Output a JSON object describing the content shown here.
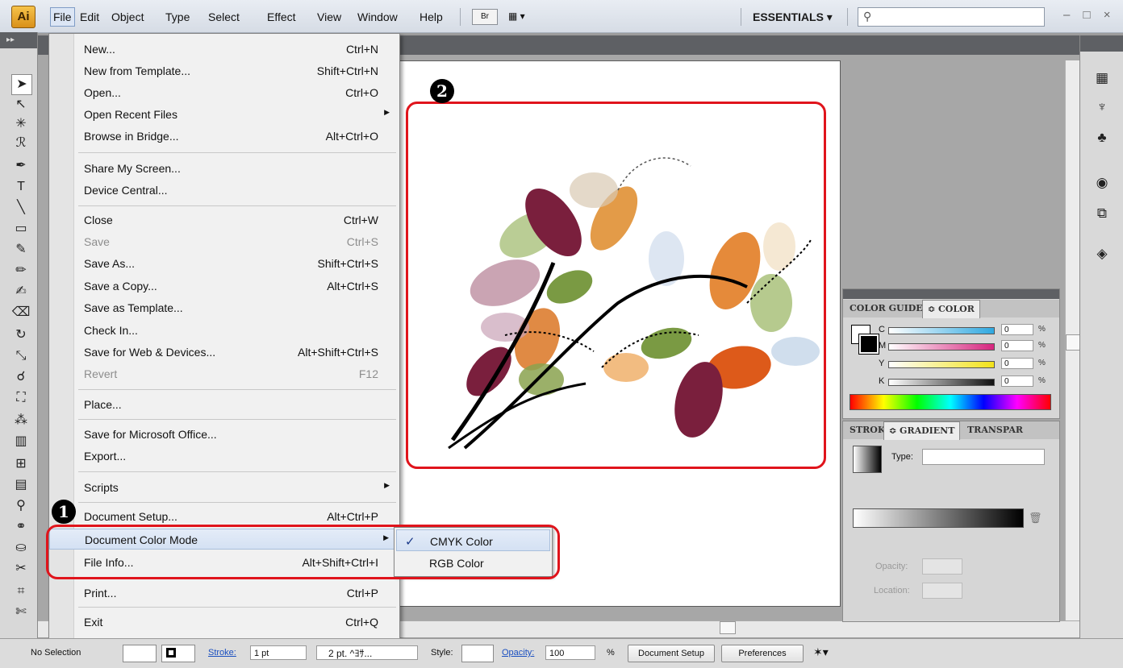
{
  "app": {
    "logo": "Ai",
    "workspace": "ESSENTIALS ▾",
    "bridge": "Br",
    "win_controls": "– □ ×"
  },
  "menubar": {
    "items": [
      "File",
      "Edit",
      "Object",
      "Type",
      "Select",
      "Effect",
      "View",
      "Window",
      "Help"
    ]
  },
  "file_menu": {
    "items": [
      {
        "label": "New...",
        "shortcut": "Ctrl+N"
      },
      {
        "label": "New from Template...",
        "shortcut": "Shift+Ctrl+N"
      },
      {
        "label": "Open...",
        "shortcut": "Ctrl+O"
      },
      {
        "label": "Open Recent Files",
        "shortcut": "",
        "submenu": true
      },
      {
        "label": "Browse in Bridge...",
        "shortcut": "Alt+Ctrl+O"
      },
      {
        "label": "Share My Screen...",
        "shortcut": ""
      },
      {
        "label": "Device Central...",
        "shortcut": ""
      },
      {
        "label": "Close",
        "shortcut": "Ctrl+W"
      },
      {
        "label": "Save",
        "shortcut": "Ctrl+S",
        "disabled": true
      },
      {
        "label": "Save As...",
        "shortcut": "Shift+Ctrl+S"
      },
      {
        "label": "Save a Copy...",
        "shortcut": "Alt+Ctrl+S"
      },
      {
        "label": "Save as Template...",
        "shortcut": ""
      },
      {
        "label": "Check In...",
        "shortcut": ""
      },
      {
        "label": "Save for Web & Devices...",
        "shortcut": "Alt+Shift+Ctrl+S"
      },
      {
        "label": "Revert",
        "shortcut": "F12",
        "disabled": true
      },
      {
        "label": "Place...",
        "shortcut": ""
      },
      {
        "label": "Save for Microsoft Office...",
        "shortcut": ""
      },
      {
        "label": "Export...",
        "shortcut": ""
      },
      {
        "label": "Scripts",
        "shortcut": "",
        "submenu": true
      },
      {
        "label": "Document Setup...",
        "shortcut": "Alt+Ctrl+P"
      },
      {
        "label": "Document Color Mode",
        "shortcut": "",
        "submenu": true,
        "highlighted": true
      },
      {
        "label": "File Info...",
        "shortcut": "Alt+Shift+Ctrl+I"
      },
      {
        "label": "Print...",
        "shortcut": "Ctrl+P"
      },
      {
        "label": "Exit",
        "shortcut": "Ctrl+Q"
      }
    ]
  },
  "color_mode_submenu": {
    "items": [
      {
        "label": "CMYK Color",
        "checked": true
      },
      {
        "label": "RGB Color",
        "checked": false
      }
    ],
    "check": "✓"
  },
  "callouts": {
    "one": "1",
    "two": "2",
    "color": "#e0141c"
  },
  "color_panel": {
    "tabs": [
      "COLOR GUIDE",
      "≎ COLOR"
    ],
    "sliders": [
      {
        "name": "C",
        "value": "0",
        "pct": "%",
        "color": "#2fa8e0"
      },
      {
        "name": "M",
        "value": "0",
        "pct": "%",
        "color": "#d6257e"
      },
      {
        "name": "Y",
        "value": "0",
        "pct": "%",
        "color": "#f2e21a"
      },
      {
        "name": "K",
        "value": "0",
        "pct": "%",
        "color": "#111111"
      }
    ]
  },
  "gradient_panel": {
    "tabs": [
      "STROKE",
      "≎ GRADIENT",
      "TRANSPAR"
    ],
    "type_label": "Type:",
    "opacity_label": "Opacity:",
    "location_label": "Location:",
    "pct": "%"
  },
  "control_bar": {
    "selection": "No Selection",
    "stroke_label": "Stroke:",
    "stroke_value": "1 pt",
    "brush": "2 pt. ^ﾖｻ...",
    "style_label": "Style:",
    "opacity_label": "Opacity:",
    "opacity_value": "100",
    "pct": "%",
    "doc_setup": "Document Setup",
    "preferences": "Preferences"
  },
  "icons": [
    "selection-tool-icon",
    "direct-selection-icon",
    "magic-wand-icon",
    "lasso-icon",
    "pen-icon",
    "type-icon",
    "line-icon",
    "rectangle-icon",
    "paintbrush-icon",
    "pencil-icon",
    "blob-brush-icon",
    "eraser-icon",
    "rotate-icon",
    "scale-icon",
    "warp-icon",
    "free-transform-icon",
    "symbol-sprayer-icon",
    "column-graph-icon",
    "mesh-icon",
    "gradient-icon",
    "eyedropper-icon",
    "blend-icon",
    "live-paint-icon",
    "slice-icon",
    "hand-icon",
    "scissors-icon"
  ]
}
